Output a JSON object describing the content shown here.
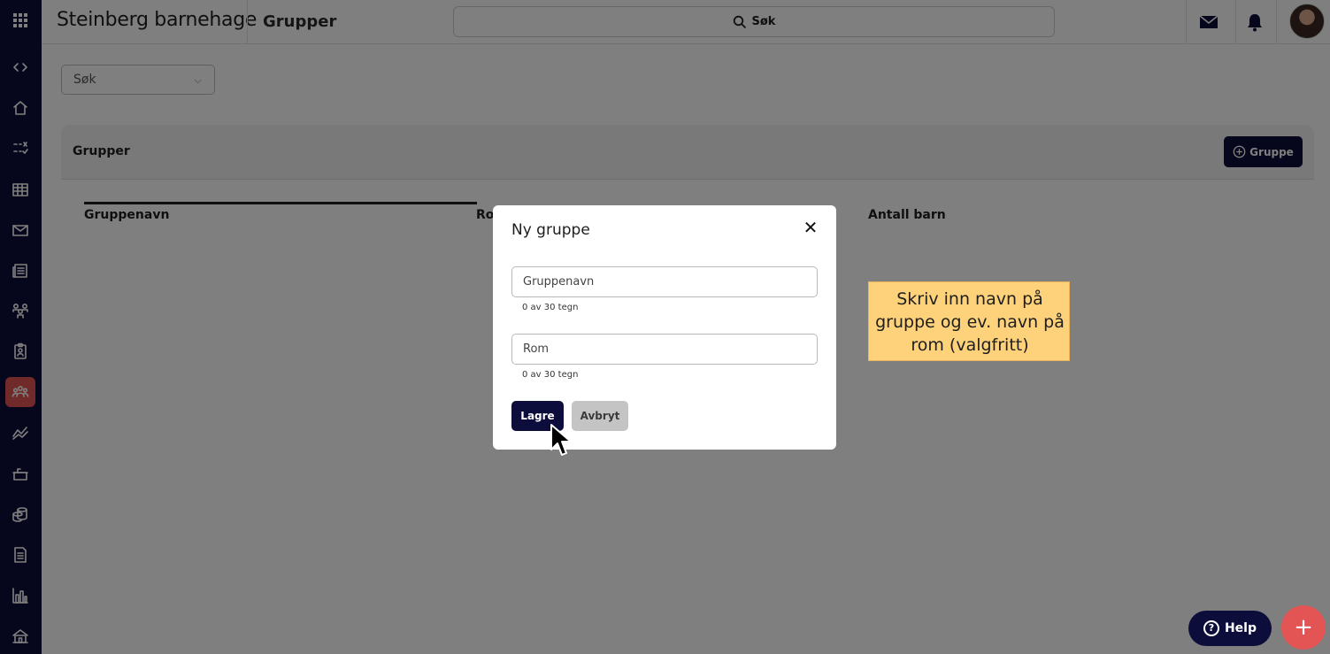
{
  "header": {
    "brand": "Steinberg barnehage",
    "page_title": "Grupper",
    "search_label": "Søk"
  },
  "toolbar": {
    "search_placeholder": "Søk"
  },
  "card": {
    "title": "Grupper",
    "add_button_label": "Gruppe",
    "columns": [
      "Gruppenavn",
      "Ro",
      "Antall barn"
    ]
  },
  "modal": {
    "title": "Ny gruppe",
    "close_symbol": "✕",
    "fields": [
      {
        "placeholder": "Gruppenavn",
        "value": "",
        "counter": "0 av 30 tegn"
      },
      {
        "placeholder": "Rom",
        "value": "",
        "counter": "0 av 30 tegn"
      }
    ],
    "save_label": "Lagre",
    "cancel_label": "Avbryt"
  },
  "callout": {
    "text": "Skriv inn navn på gruppe og ev. navn på rom (valgfritt)"
  },
  "help": {
    "label": "Help",
    "icon_glyph": "?"
  },
  "fab": {
    "glyph": "+"
  },
  "sidebar": {
    "active_item": "groups-icon",
    "items": [
      "apps-icon",
      "collapse-icon",
      "home-icon",
      "checklist-icon",
      "calendar-icon",
      "mail-icon",
      "news-icon",
      "people-icon",
      "badge-icon",
      "groups-icon",
      "chart-line-icon",
      "kitchen-icon",
      "coins-icon",
      "document-icon",
      "bar-chart-icon",
      "building-icon"
    ]
  },
  "colors": {
    "navy": "#0d0d3b",
    "accent_red": "#e35454",
    "callout_yellow": "#fdd27a"
  }
}
